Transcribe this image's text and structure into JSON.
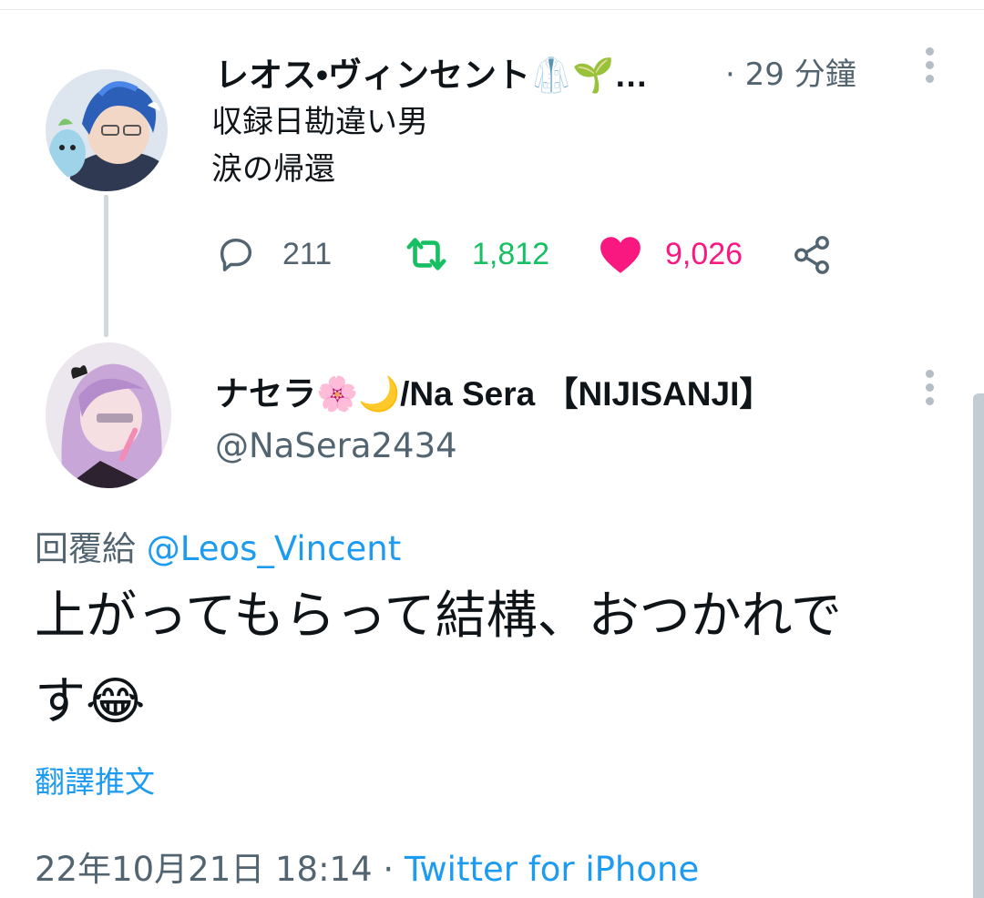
{
  "tweet1": {
    "display_name": "レオス•ヴィンセント",
    "name_emojis": "🥼🌱",
    "truncation": "…",
    "separator": "·",
    "time": "29 分鐘",
    "lines": [
      "収録日勘違い男",
      "涙の帰還"
    ],
    "reply_count": "211",
    "retweet_count": "1,812",
    "like_count": "9,026",
    "colors": {
      "retweet": "#17bf63",
      "like": "#f91880",
      "icon": "#536471"
    },
    "icons": [
      "reply-icon",
      "retweet-icon",
      "like-icon-filled",
      "share-icon"
    ]
  },
  "tweet2": {
    "display_name_prefix": "ナセラ",
    "name_emojis": "🌸🌙",
    "display_name_suffix": "/Na Sera 【NIJISANJI】",
    "handle": "@NaSera2434",
    "reply_prefix": "回覆給",
    "reply_to_handle": "@Leos_Vincent",
    "text_line1": "上がってもらって結構、おつかれで",
    "text_line2": "す",
    "text_emoji": "😂",
    "translate_label": "翻譯推文",
    "timestamp": "22年10月21日 18:14",
    "separator": "·",
    "source": "Twitter for iPhone"
  },
  "colors": {
    "link": "#1d9bf0",
    "secondary_text": "#536471",
    "thread_line": "#cfd9de"
  }
}
